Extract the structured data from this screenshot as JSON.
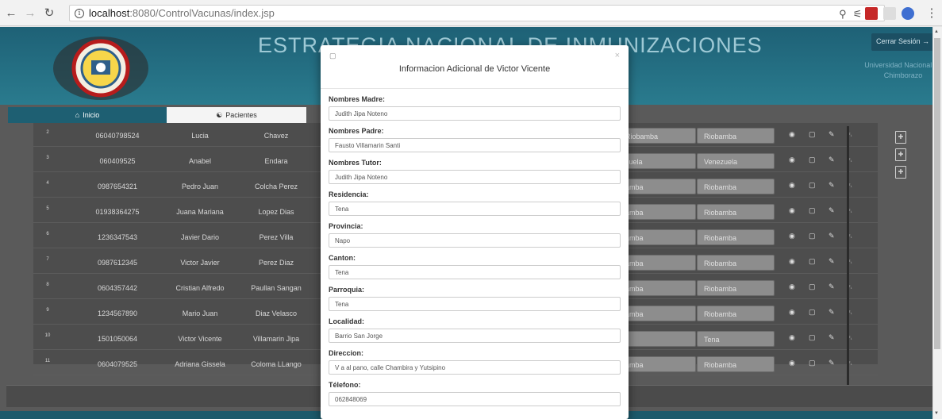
{
  "browser": {
    "url_host": "localhost",
    "url_path": ":8080/ControlVacunas/index.jsp"
  },
  "header": {
    "title": "ESTRATEGIA NACIONAL DE INMUNIZACIONES",
    "logout_label": "Cerrar Sesión →",
    "university": "Universidad Nacional de Chimborazo",
    "logo_text": "NACIONAL DE CHIMBORAZO"
  },
  "tabs": [
    {
      "label": "Inicio",
      "icon": "home-icon"
    },
    {
      "label": "Pacientes",
      "icon": "users-icon"
    }
  ],
  "patients": [
    {
      "num": "2",
      "id": "06040798524",
      "nombre": "Lucia",
      "apellido": "Chavez",
      "ciudad1": "Riobamba",
      "ciudad2": "Riobamba",
      "show_left": ""
    },
    {
      "num": "3",
      "id": "060409525",
      "nombre": "Anabel",
      "apellido": "Endara",
      "ciudad1": "zuela",
      "ciudad2": "Venezuela"
    },
    {
      "num": "4",
      "id": "0987654321",
      "nombre": "Pedro Juan",
      "apellido": "Colcha Perez",
      "ciudad1": "amba",
      "ciudad2": "Riobamba"
    },
    {
      "num": "5",
      "id": "01938364275",
      "nombre": "Juana Mariana",
      "apellido": "Lopez Dias",
      "ciudad1": "amba",
      "ciudad2": "Riobamba"
    },
    {
      "num": "6",
      "id": "1236347543",
      "nombre": "Javier Dario",
      "apellido": "Perez Villa",
      "ciudad1": "amba",
      "ciudad2": "Riobamba"
    },
    {
      "num": "7",
      "id": "0987612345",
      "nombre": "Victor Javier",
      "apellido": "Perez Diaz",
      "ciudad1": "amba",
      "ciudad2": "Riobamba"
    },
    {
      "num": "8",
      "id": "0604357442",
      "nombre": "Cristian Alfredo",
      "apellido": "Paullan Sangan",
      "ciudad1": "amba",
      "ciudad2": "Riobamba"
    },
    {
      "num": "9",
      "id": "1234567890",
      "nombre": "Mario Juan",
      "apellido": "Diaz Velasco",
      "ciudad1": "amba",
      "ciudad2": "Riobamba"
    },
    {
      "num": "10",
      "id": "1501050064",
      "nombre": "Victor Vicente",
      "apellido": "Villamarin Jipa",
      "ciudad1": "",
      "ciudad2": "Tena"
    },
    {
      "num": "11",
      "id": "0604079525",
      "nombre": "Adriana Gissela",
      "apellido": "Coloma LLango",
      "ciudad1": "amba",
      "ciudad2": "Riobamba"
    }
  ],
  "modal": {
    "title": "Informacion Adicional de Victor Vicente",
    "fields": [
      {
        "label": "Nombres Madre:",
        "value": "Judith Jipa Noteno"
      },
      {
        "label": "Nombres Padre:",
        "value": "Fausto Villamarin Santi"
      },
      {
        "label": "Nombres Tutor:",
        "value": "Judith Jipa Noteno"
      },
      {
        "label": "Residencia:",
        "value": "Tena"
      },
      {
        "label": "Provincia:",
        "value": "Napo"
      },
      {
        "label": "Canton:",
        "value": "Tena"
      },
      {
        "label": "Parroquia:",
        "value": "Tena"
      },
      {
        "label": "Localidad:",
        "value": "Barrio San Jorge"
      },
      {
        "label": "Direccion:",
        "value": "V  a al pano, calle Chambira y Yutsipino"
      },
      {
        "label": "Télefono:",
        "value": "062848069"
      }
    ]
  },
  "colors": {
    "header": "#1e6176",
    "backdrop": "#5a5a5a",
    "modal": "#ffffff"
  }
}
